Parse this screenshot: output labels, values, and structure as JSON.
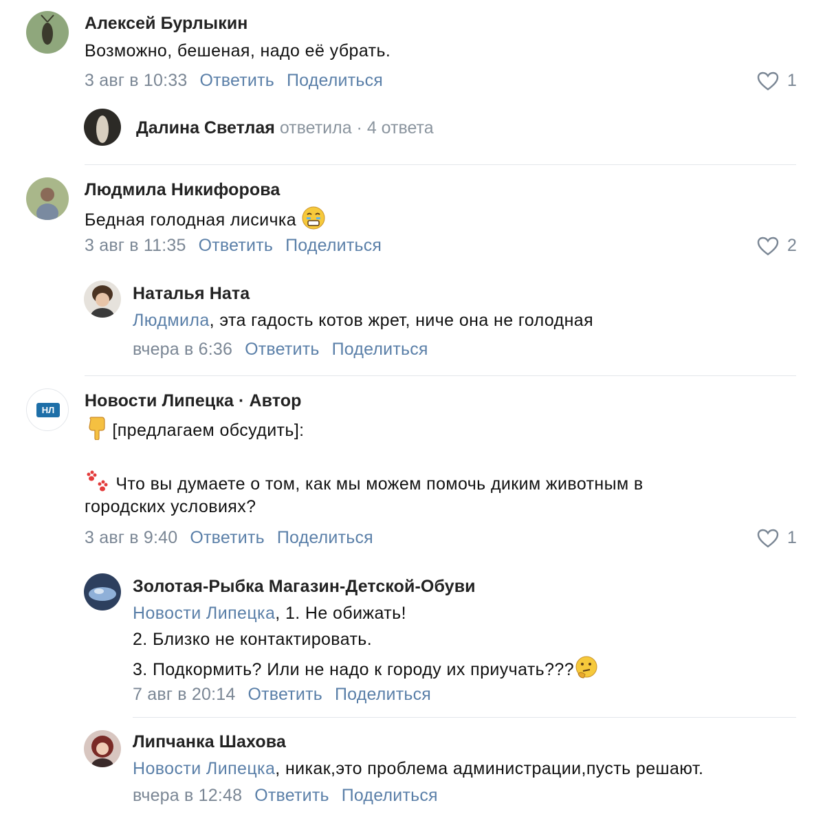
{
  "comments": [
    {
      "author": "Алексей Бурлыкин",
      "text": "Возможно, бешеная, надо её убрать.",
      "date": "3 авг в 10:33",
      "reply_label": "Ответить",
      "share_label": "Поделиться",
      "likes": "1",
      "thread": {
        "name": "Далина Светлая",
        "meta": "ответила · 4 ответа"
      }
    },
    {
      "author": "Людмила Никифорова",
      "text": "Бедная голодная лисичка",
      "date": "3 авг в 11:35",
      "reply_label": "Ответить",
      "share_label": "Поделиться",
      "likes": "2",
      "reply": {
        "author": "Наталья Ната",
        "mention": "Людмила",
        "text": ", эта гадость котов жрет, ниче она не голодная",
        "date": "вчера в 6:36",
        "reply_label": "Ответить",
        "share_label": "Поделиться"
      }
    },
    {
      "author": "Новости Липецка · Автор",
      "avatar_text": "НЛ",
      "line1": "[предлагаем обсудить]:",
      "line2": " Что вы думаете о том, как мы можем помочь диким животным в",
      "line3": "городских условиях?",
      "date": "3 авг в 9:40",
      "reply_label": "Ответить",
      "share_label": "Поделиться",
      "likes": "1",
      "replies": [
        {
          "author": "Золотая-Рыбка Магазин-Детской-Обуви",
          "mention": "Новости Липецка",
          "line1": ", 1. Не обижать!",
          "line2": "2. Близко не контактировать.",
          "line3": "3. Подкормить? Или не надо к городу их приучать???",
          "date": "7 авг в 20:14",
          "reply_label": "Ответить",
          "share_label": "Поделиться"
        },
        {
          "author": "Липчанка Шахова",
          "mention": "Новости Липецка",
          "text": ", никак,это проблема администрации,пусть решают.",
          "date": "вчера в 12:48",
          "reply_label": "Ответить",
          "share_label": "Поделиться"
        }
      ]
    }
  ],
  "colors": {
    "link": "#5a7fa8",
    "muted": "#7a8694",
    "divider": "#e3e6ea"
  }
}
